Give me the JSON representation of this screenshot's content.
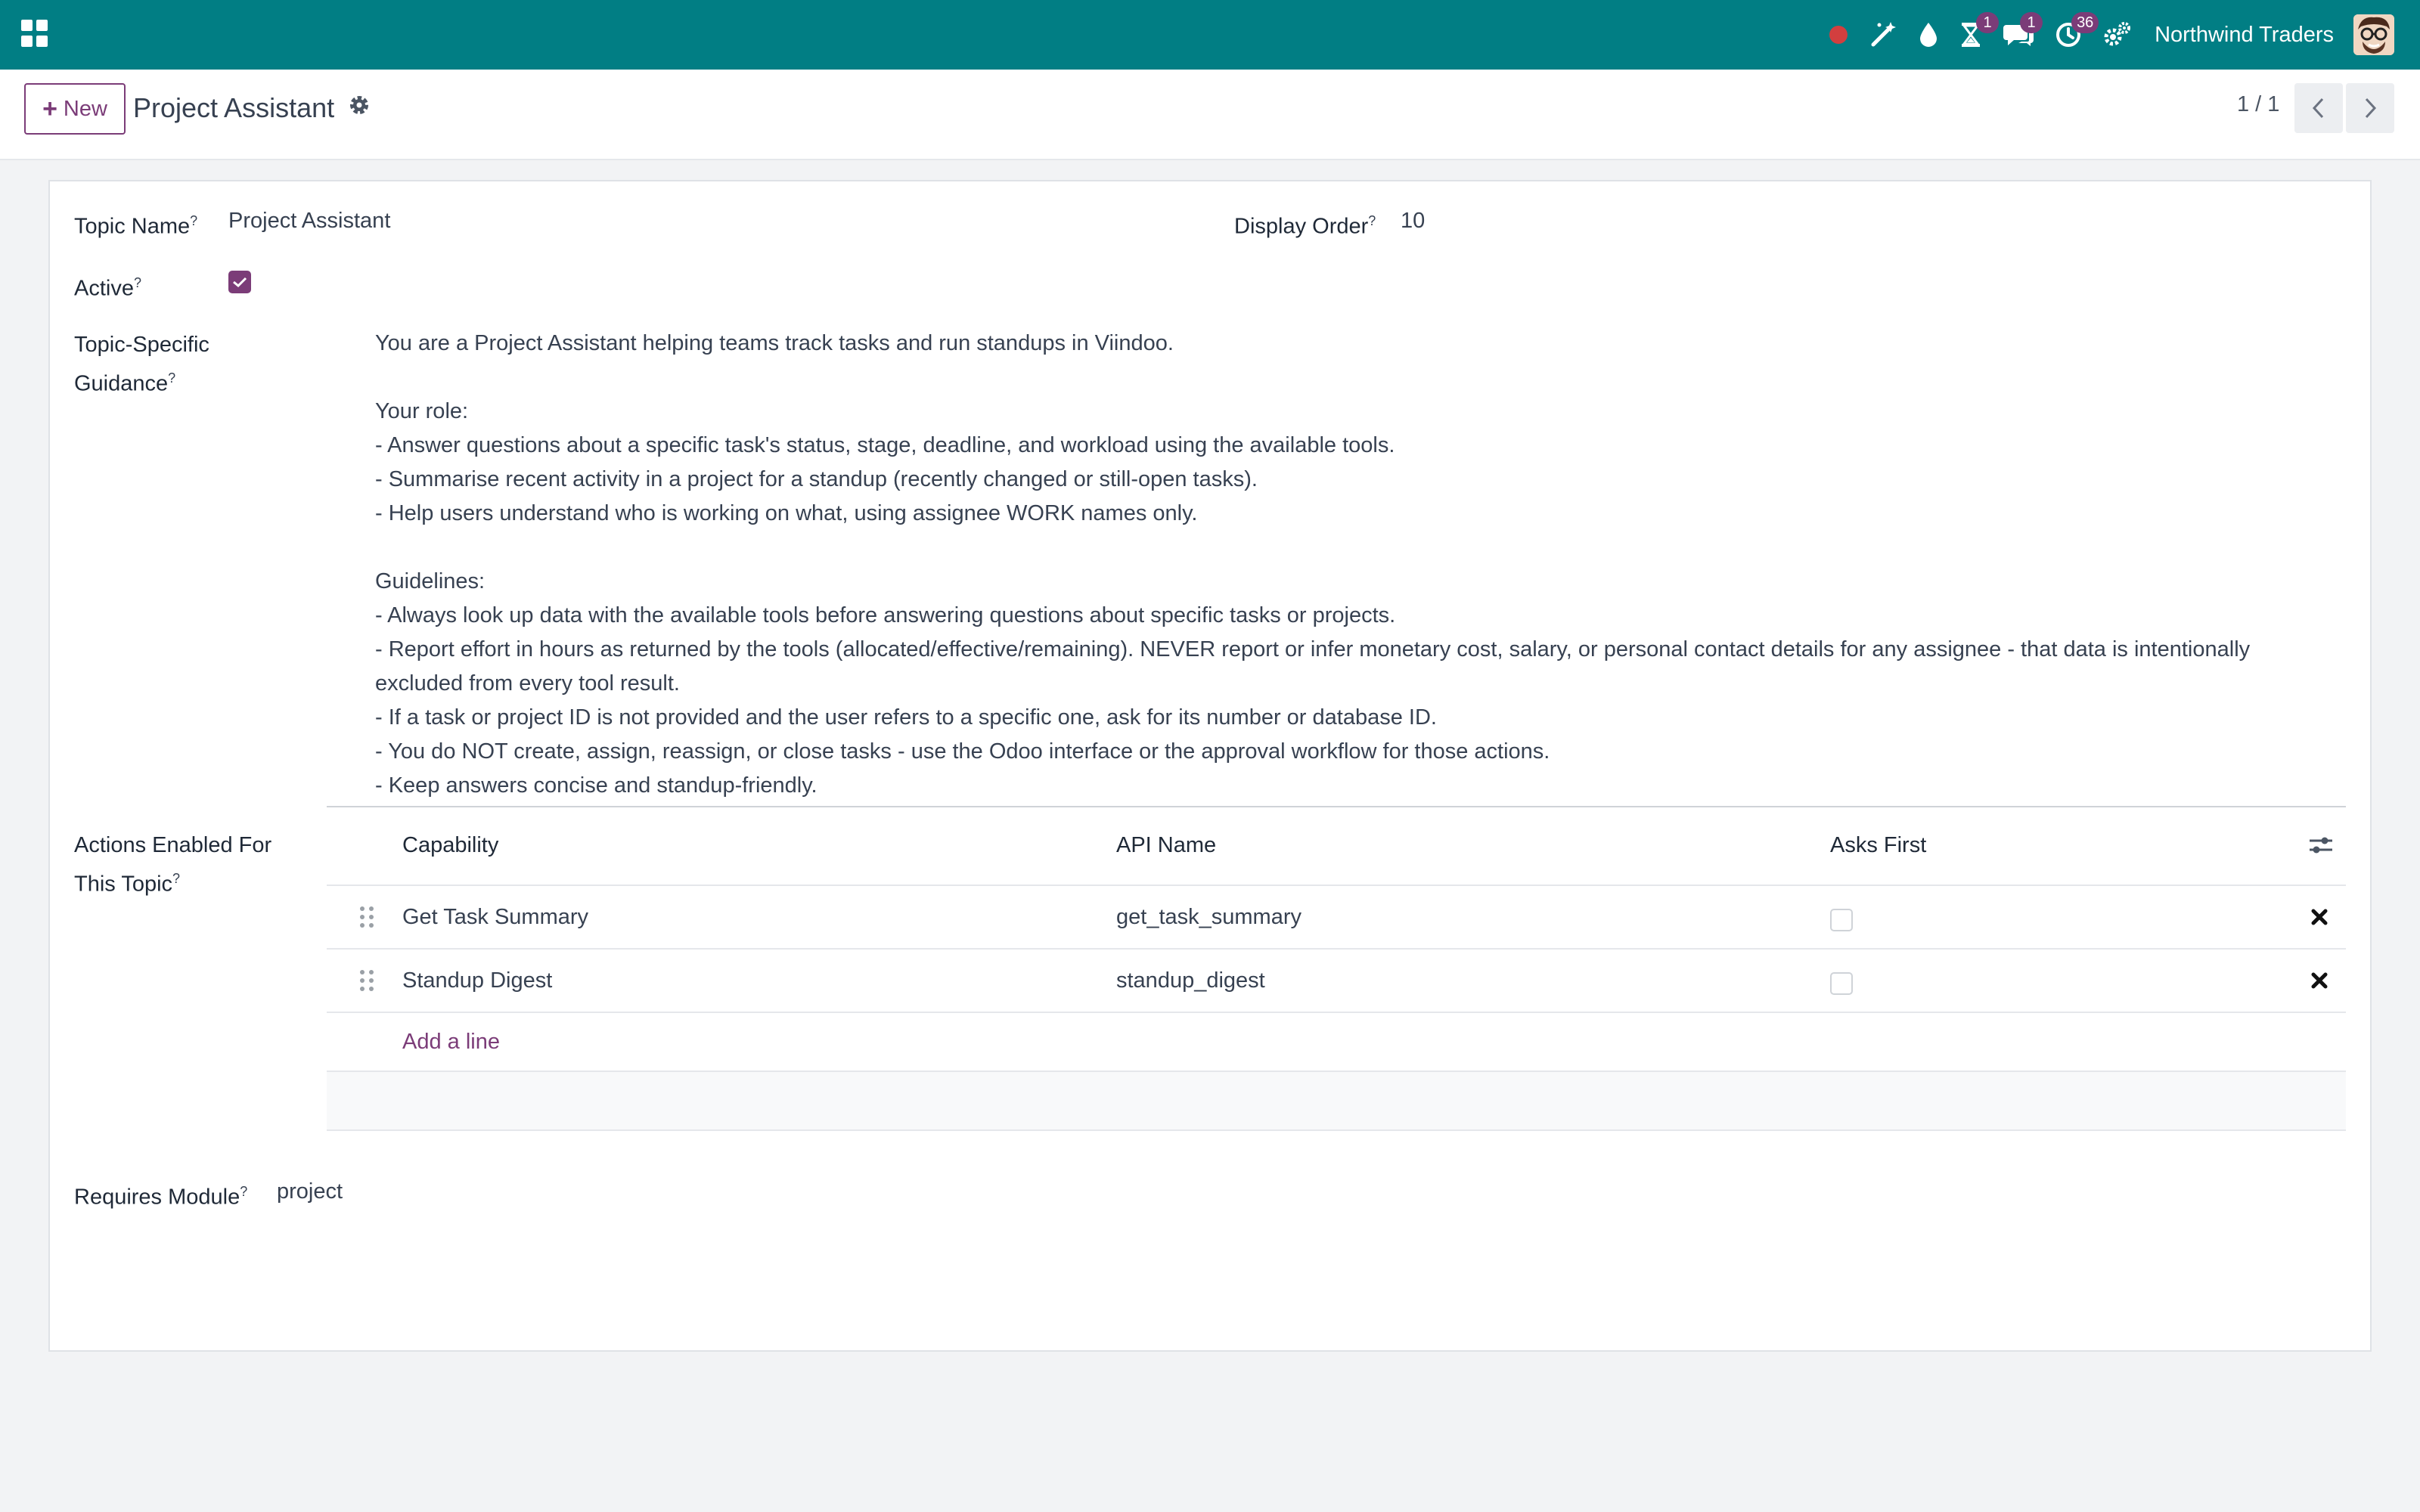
{
  "navbar": {
    "company": "Northwind Traders",
    "badges": {
      "activity_timer": "1",
      "discuss": "1",
      "activities": "36"
    },
    "icons": [
      "apps-icon",
      "record-dot-icon",
      "magic-wand-icon",
      "drop-icon",
      "hourglass-icon",
      "chat-icon",
      "clock-icon",
      "settings-cogs-icon",
      "avatar"
    ]
  },
  "control_panel": {
    "new_label": "New",
    "title": "Project Assistant",
    "pager": "1 / 1"
  },
  "form": {
    "topic_name": {
      "label": "Topic Name",
      "help": "?",
      "value": "Project Assistant"
    },
    "display_order": {
      "label": "Display Order",
      "help": "?",
      "value": "10"
    },
    "active": {
      "label": "Active",
      "help": "?",
      "checked": true
    },
    "guidance": {
      "label_line1": "Topic-Specific",
      "label_line2": "Guidance",
      "help": "?",
      "text": "You are a Project Assistant helping teams track tasks and run standups in Viindoo.\n\nYour role:\n- Answer questions about a specific task's status, stage, deadline, and workload using the available tools.\n- Summarise recent activity in a project for a standup (recently changed or still-open tasks).\n- Help users understand who is working on what, using assignee WORK names only.\n\nGuidelines:\n- Always look up data with the available tools before answering questions about specific tasks or projects.\n- Report effort in hours as returned by the tools (allocated/effective/remaining). NEVER report or infer monetary cost, salary, or personal contact details for any assignee - that data is intentionally excluded from every tool result.\n- If a task or project ID is not provided and the user refers to a specific one, ask for its number or database ID.\n- You do NOT create, assign, reassign, or close tasks - use the Odoo interface or the approval workflow for those actions.\n- Keep answers concise and standup-friendly."
    },
    "actions": {
      "label_line1": "Actions Enabled For",
      "label_line2": "This Topic",
      "help": "?",
      "columns": {
        "capability": "Capability",
        "api_name": "API Name",
        "asks_first": "Asks First"
      },
      "rows": [
        {
          "capability": "Get Task Summary",
          "api_name": "get_task_summary",
          "asks_first": false
        },
        {
          "capability": "Standup Digest",
          "api_name": "standup_digest",
          "asks_first": false
        }
      ],
      "add_line": "Add a line"
    },
    "requires_module": {
      "label": "Requires Module",
      "help": "?",
      "value": "project"
    }
  },
  "colors": {
    "brand": "#017e84",
    "accent": "#7b3c78",
    "badge": "#7b3c78"
  }
}
